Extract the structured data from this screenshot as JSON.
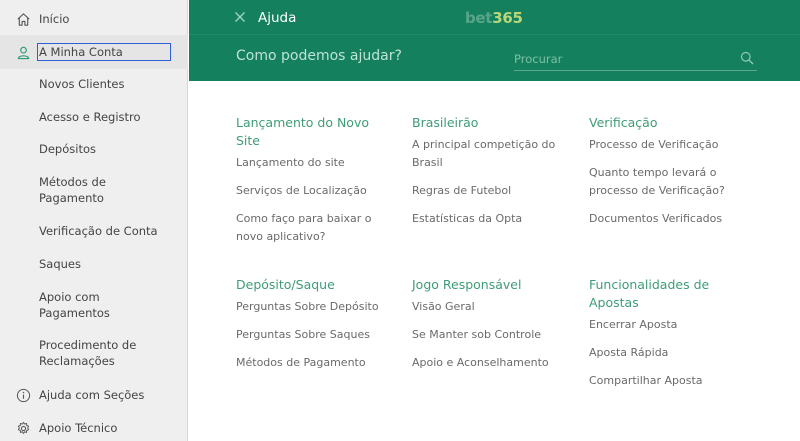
{
  "sidebar": {
    "items": [
      {
        "label": "Início",
        "icon": "home-icon"
      },
      {
        "label": "A Minha Conta",
        "icon": "user-icon"
      },
      {
        "label": "Novos Clientes"
      },
      {
        "label": "Acesso e Registro"
      },
      {
        "label": "Depósitos"
      },
      {
        "label": "Métodos de Pagamento"
      },
      {
        "label": "Verificação de Conta"
      },
      {
        "label": "Saques"
      },
      {
        "label": "Apoio com Pagamentos"
      },
      {
        "label": "Procedimento de Reclamações"
      },
      {
        "label": "Ajuda com Seções",
        "icon": "info-icon"
      },
      {
        "label": "Apoio Técnico",
        "icon": "gear-icon"
      }
    ]
  },
  "header": {
    "title": "Ajuda",
    "logo_part1": "bet",
    "logo_part2": "365",
    "question": "Como podemos ajudar?",
    "search_placeholder": "Procurar"
  },
  "sections": [
    {
      "title": "Lançamento do Novo Site",
      "links": [
        "Lançamento do site",
        "Serviços de Localização",
        "Como faço para baixar o novo aplicativo?"
      ]
    },
    {
      "title": "Brasileirão",
      "links": [
        "A principal competição do Brasil",
        "Regras de Futebol",
        "Estatísticas da Opta"
      ]
    },
    {
      "title": "Verificação",
      "links": [
        "Processo de Verificação",
        "Quanto tempo levará o processo de Verificação?",
        "Documentos Verificados"
      ]
    },
    {
      "title": "Depósito/Saque",
      "links": [
        "Perguntas Sobre Depósito",
        "Perguntas Sobre Saques",
        "Métodos de Pagamento"
      ]
    },
    {
      "title": "Jogo Responsável",
      "links": [
        "Visão Geral",
        "Se Manter sob Controle",
        "Apoio e Aconselhamento"
      ]
    },
    {
      "title": "Funcionalidades de Apostas",
      "links": [
        "Encerrar Aposta",
        "Aposta Rápida",
        "Compartilhar Aposta"
      ]
    }
  ],
  "colors": {
    "header_green": "#14805e",
    "section_title_green": "#3f9c78",
    "sidebar_bg": "#efefef"
  }
}
